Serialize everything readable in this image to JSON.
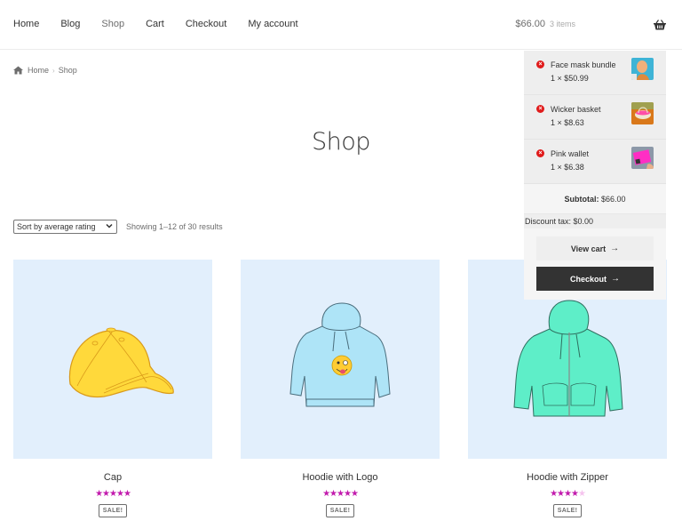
{
  "header": {
    "nav": [
      {
        "label": "Home",
        "current": false
      },
      {
        "label": "Blog",
        "current": false
      },
      {
        "label": "Shop",
        "current": true
      },
      {
        "label": "Cart",
        "current": false
      },
      {
        "label": "Checkout",
        "current": false
      },
      {
        "label": "My account",
        "current": false
      }
    ],
    "cart": {
      "amount": "$66.00",
      "count": "3 items",
      "icon": "basket-icon"
    }
  },
  "breadcrumb": {
    "icon": "home-icon",
    "items": [
      "Home",
      "Shop"
    ],
    "separator": "›"
  },
  "page": {
    "title": "Shop"
  },
  "sorting": {
    "selected": "Sort by average rating",
    "result_count": "Showing 1–12 of 30 results"
  },
  "products": [
    {
      "name": "Cap",
      "rating": 5,
      "badge": "SALE!",
      "image": "yellow-cap"
    },
    {
      "name": "Hoodie with Logo",
      "rating": 5,
      "badge": "SALE!",
      "image": "blue-hoodie-emoji"
    },
    {
      "name": "Hoodie with Zipper",
      "rating": 4,
      "badge": "SALE!",
      "image": "green-zip-hoodie"
    }
  ],
  "mini_cart": {
    "items": [
      {
        "name": "Face mask bundle",
        "qty": "1 × $50.99"
      },
      {
        "name": "Wicker basket",
        "qty": "1 × $8.63"
      },
      {
        "name": "Pink wallet",
        "qty": "1 × $6.38"
      }
    ],
    "subtotal_label": "Subtotal:",
    "subtotal_value": "$66.00",
    "discount": "Discount tax: $0.00",
    "view_cart": "View cart",
    "checkout": "Checkout",
    "arrow": "→"
  },
  "colors": {
    "star": "#c21bad",
    "star_empty": "#f5c3ee",
    "remove": "#e01b1b",
    "thumb_bg": "#e2effc",
    "checkout_bg": "#333333"
  }
}
